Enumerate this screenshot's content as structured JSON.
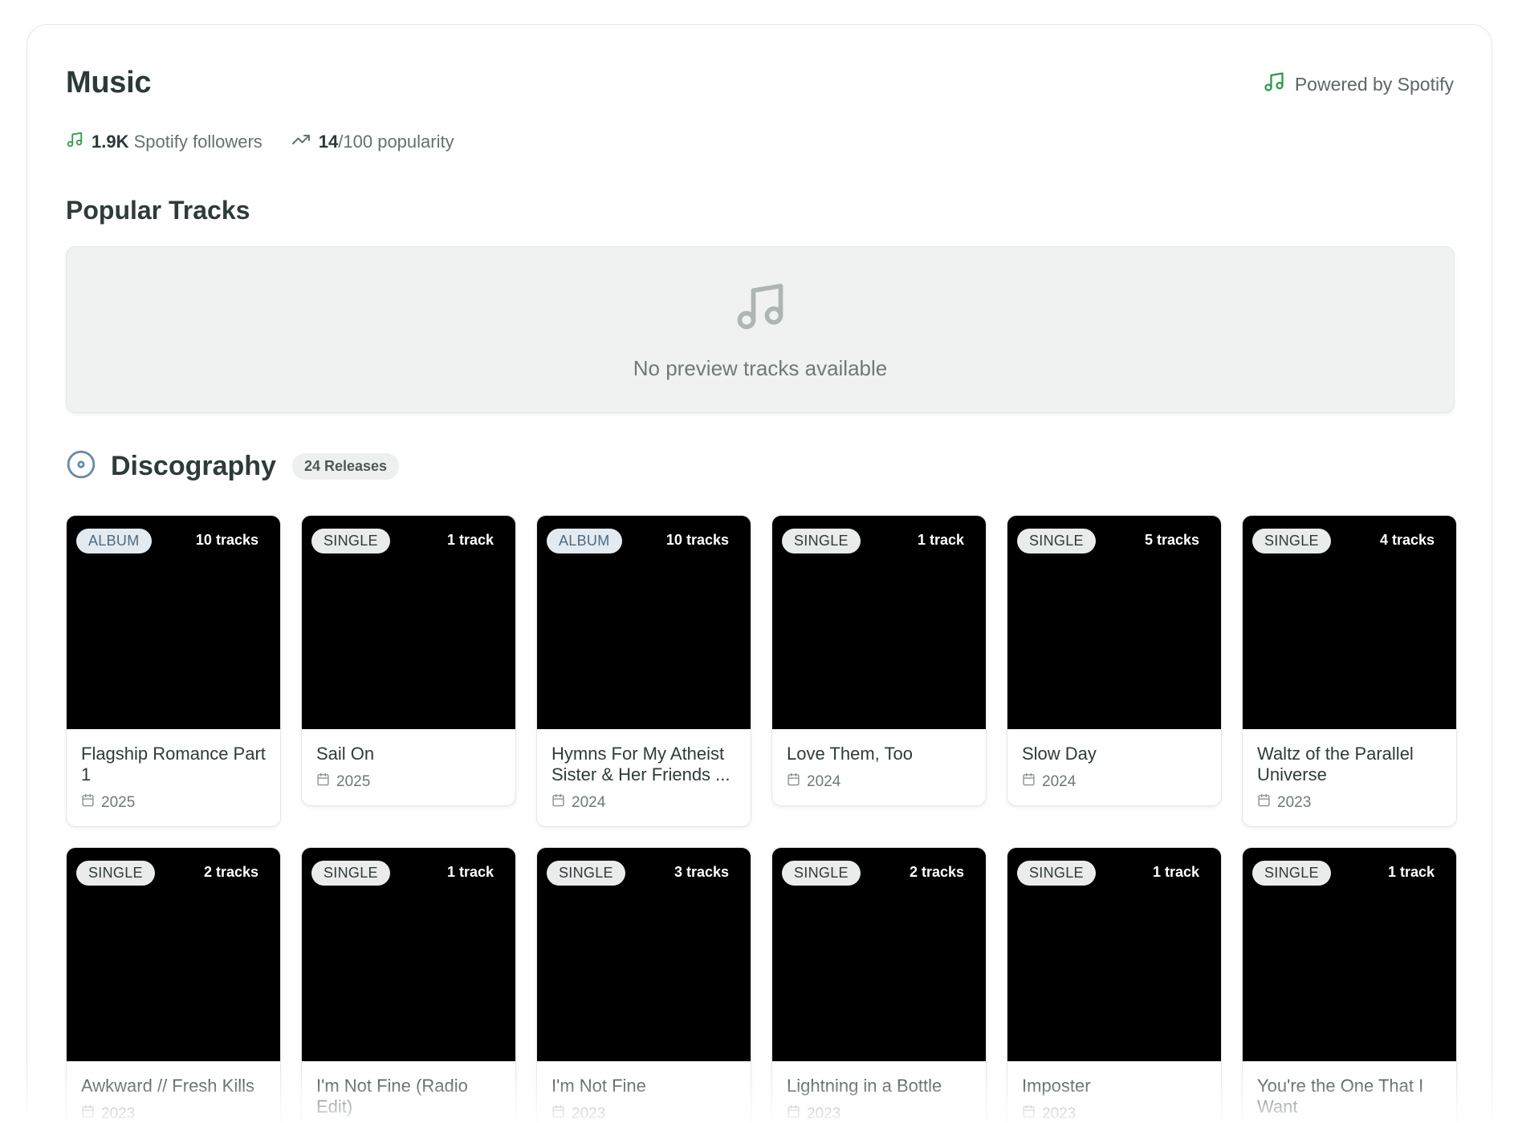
{
  "header": {
    "title": "Music",
    "powered_by": "Powered by Spotify"
  },
  "stats": {
    "followers_value": "1.9K",
    "followers_label": "Spotify followers",
    "popularity_value": "14",
    "popularity_label": "/100 popularity"
  },
  "popular_tracks": {
    "heading": "Popular Tracks",
    "empty_message": "No preview tracks available"
  },
  "discography": {
    "heading": "Discography",
    "count_label": "24 Releases",
    "releases": [
      {
        "type": "ALBUM",
        "tracks": "10 tracks",
        "name": "Flagship Romance Part 1",
        "year": "2025"
      },
      {
        "type": "SINGLE",
        "tracks": "1 track",
        "name": "Sail On",
        "year": "2025"
      },
      {
        "type": "ALBUM",
        "tracks": "10 tracks",
        "name": "Hymns For My Atheist Sister & Her Friends ...",
        "year": "2024"
      },
      {
        "type": "SINGLE",
        "tracks": "1 track",
        "name": "Love Them, Too",
        "year": "2024"
      },
      {
        "type": "SINGLE",
        "tracks": "5 tracks",
        "name": "Slow Day",
        "year": "2024"
      },
      {
        "type": "SINGLE",
        "tracks": "4 tracks",
        "name": "Waltz of the Parallel Universe",
        "year": "2023"
      },
      {
        "type": "SINGLE",
        "tracks": "2 tracks",
        "name": "Awkward // Fresh Kills",
        "year": "2023"
      },
      {
        "type": "SINGLE",
        "tracks": "1 track",
        "name": "I'm Not Fine (Radio Edit)",
        "year": "2023"
      },
      {
        "type": "SINGLE",
        "tracks": "3 tracks",
        "name": "I'm Not Fine",
        "year": "2023"
      },
      {
        "type": "SINGLE",
        "tracks": "2 tracks",
        "name": "Lightning in a Bottle",
        "year": "2023"
      },
      {
        "type": "SINGLE",
        "tracks": "1 track",
        "name": "Imposter",
        "year": "2023"
      },
      {
        "type": "SINGLE",
        "tracks": "1 track",
        "name": "You're the One That I Want",
        "year": ""
      }
    ]
  },
  "icons": {
    "music_note": "music-note-icon",
    "trending_up": "trending-up-icon",
    "disc": "disc-icon",
    "calendar": "calendar-icon"
  },
  "colors": {
    "spotify_green": "#1db954",
    "album_badge_text": "#4a6b85"
  }
}
